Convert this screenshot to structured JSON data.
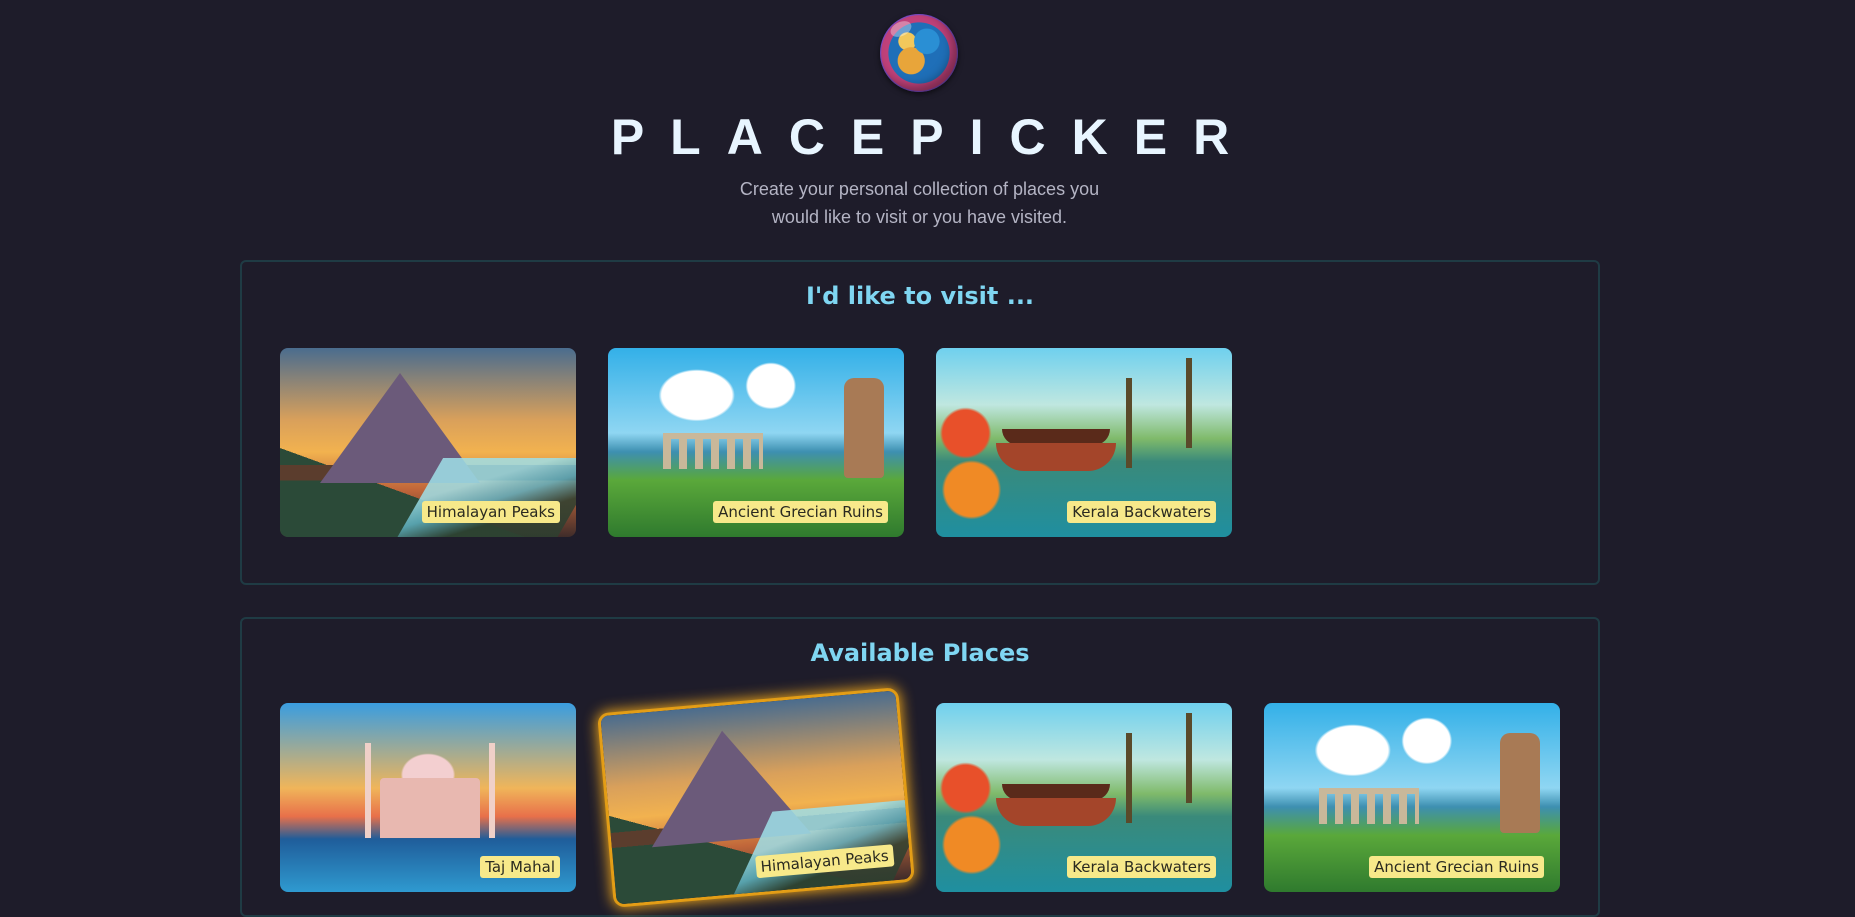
{
  "app": {
    "title": "PLACEPICKER",
    "subtitle": "Create your personal collection of places you would like to visit or you have visited."
  },
  "visit_section": {
    "heading": "I'd like to visit ...",
    "places": [
      {
        "title": "Himalayan Peaks"
      },
      {
        "title": "Ancient Grecian Ruins"
      },
      {
        "title": "Kerala Backwaters"
      }
    ]
  },
  "available_section": {
    "heading": "Available Places",
    "places": [
      {
        "title": "Taj Mahal"
      },
      {
        "title": "Himalayan Peaks"
      },
      {
        "title": "Kerala Backwaters"
      },
      {
        "title": "Ancient Grecian Ruins"
      }
    ]
  },
  "colors": {
    "background": "#1e1c2a",
    "accent": "#7fd6f2",
    "label_bg": "#f7e98a",
    "highlight_glow": "#f3a91a"
  }
}
